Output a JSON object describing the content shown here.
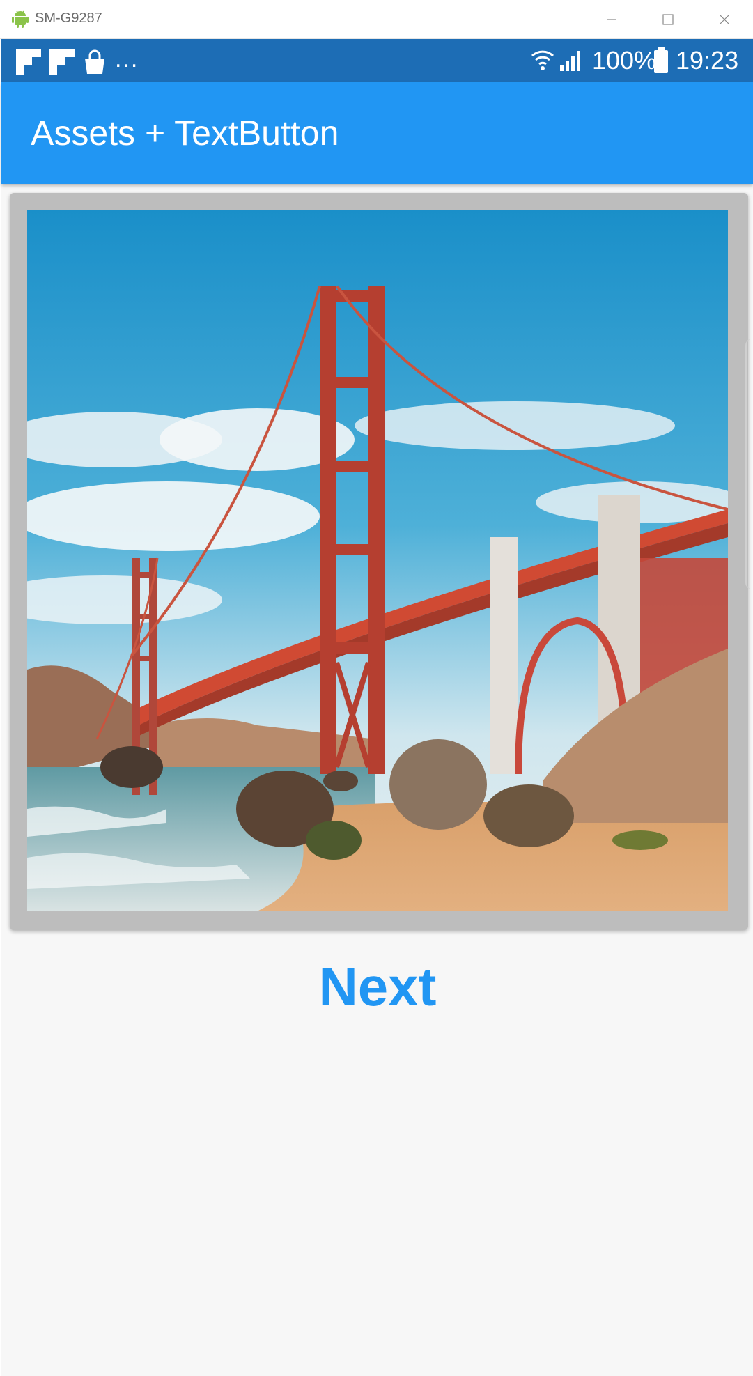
{
  "window": {
    "title": "SM-G9287",
    "icons": {
      "app": "android-icon",
      "minimize": "minimize-icon",
      "maximize": "maximize-icon",
      "close": "close-icon"
    }
  },
  "statusbar": {
    "notification_icons": [
      "flipboard-icon",
      "flipboard-icon",
      "shopping-bag-icon"
    ],
    "overflow": "...",
    "battery_percent": "100%",
    "time": "19:23"
  },
  "appbar": {
    "title": "Assets + TextButton"
  },
  "image": {
    "alt": "Golden Gate Bridge from the beach"
  },
  "button": {
    "label": "Next"
  },
  "colors": {
    "statusbar": "#1d6db5",
    "appbar": "#2196f3",
    "accent": "#2196f3",
    "card": "#bdbdbd",
    "background": "#f7f7f7"
  }
}
